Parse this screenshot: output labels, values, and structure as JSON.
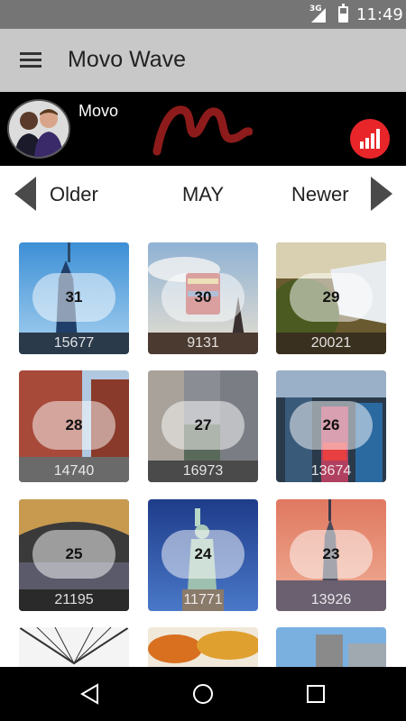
{
  "status_bar": {
    "network": "3G",
    "time": "11:49"
  },
  "app_bar": {
    "title": "Movo Wave",
    "menu_icon": "hamburger-menu-icon"
  },
  "banner": {
    "brand": "Movo",
    "logo": "movo-logo",
    "stats_icon": "bar-chart-icon",
    "accent_color": "#e8262a"
  },
  "month_nav": {
    "older_label": "Older",
    "month_label": "MAY",
    "newer_label": "Newer"
  },
  "tiles": [
    {
      "day": "31",
      "count": "15677",
      "scene": "skyscraper-sky"
    },
    {
      "day": "30",
      "count": "9131",
      "scene": "water-tower-bridge"
    },
    {
      "day": "29",
      "count": "20021",
      "scene": "waterfall-forest"
    },
    {
      "day": "28",
      "count": "14740",
      "scene": "street-brick-buildings"
    },
    {
      "day": "27",
      "count": "16973",
      "scene": "city-aerial"
    },
    {
      "day": "26",
      "count": "13674",
      "scene": "times-square"
    },
    {
      "day": "25",
      "count": "21195",
      "scene": "arena-crowd"
    },
    {
      "day": "24",
      "count": "11771",
      "scene": "statue-of-liberty"
    },
    {
      "day": "23",
      "count": "13926",
      "scene": "empire-state-sunset"
    },
    {
      "day": "",
      "count": "",
      "scene": "bridge-cables"
    },
    {
      "day": "",
      "count": "",
      "scene": "autumn-trees"
    },
    {
      "day": "",
      "count": "",
      "scene": "tower-blue-sky"
    }
  ],
  "nav_bar": {
    "back_icon": "back-triangle-icon",
    "home_icon": "home-circle-icon",
    "recents_icon": "recents-square-icon"
  }
}
